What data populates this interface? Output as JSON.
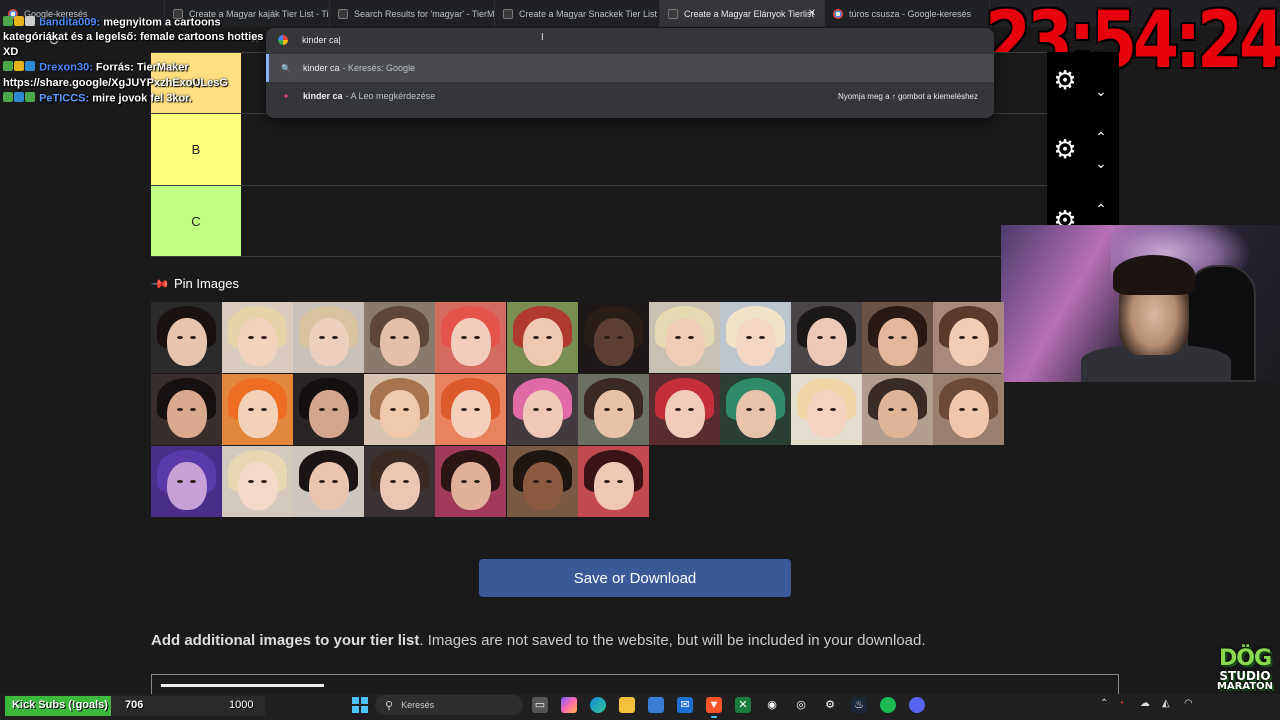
{
  "browser": {
    "tabs": [
      {
        "label": "Google-keresés",
        "favicon": "google"
      },
      {
        "label": "Create a Magyar kaják Tier List - Tier",
        "favicon": "tiermaker"
      },
      {
        "label": "Search Results for 'magyar' - TierMak",
        "favicon": "tiermaker"
      },
      {
        "label": "Create a Magyar Snackek Tier List - T",
        "favicon": "tiermaker"
      },
      {
        "label": "Create a Magyar Elányok Tierlist",
        "favicon": "tiermaker",
        "active": true
      },
      {
        "label": "túros csusza - Google-keresés",
        "favicon": "google"
      }
    ],
    "close_glyph": "✕",
    "omnibox": {
      "value": "kinder ca",
      "suggestions": [
        {
          "query": "kinder ca",
          "suffix": " - Keresés: Google",
          "icon": "search-icon",
          "selected": true
        },
        {
          "query": "kinder ca",
          "suffix": " - A Leo megkérdezése",
          "icon": "leo-icon",
          "hint": "Nyomja meg a ↑ gombot a kiemeléshez"
        }
      ]
    }
  },
  "chat": {
    "lines": [
      {
        "user": "bandita009:",
        "text": "megnyitom a cartoons kategóriákat és a legelső: female cartoons hotties XD",
        "badges": [
          "#4aa84a",
          "#e6b31e",
          "#cccccc"
        ]
      },
      {
        "user": "Drexon30:",
        "text": "Forrás: TierMaker https://share.google/XgJUYPxzhExoULesG",
        "badges": [
          "#4aa84a",
          "#e6b31e",
          "#2d8bd6"
        ]
      },
      {
        "user": "PeTICCS:",
        "text": "mire jovok fel 3kor.",
        "badges": [
          "#4aa84a",
          "#2d8bd6",
          "#4aa84a"
        ]
      }
    ]
  },
  "clock": "23:54:24",
  "tiers": [
    {
      "label": "A",
      "color": "#ffdf80"
    },
    {
      "label": "B",
      "color": "#ffff7f"
    },
    {
      "label": "C",
      "color": "#bfff7f"
    }
  ],
  "pin": {
    "title": "Pin Images"
  },
  "thumbnails": [
    {
      "bg": "#2a2a2a",
      "hair": "#1a1210",
      "skin": "#e7c4ad"
    },
    {
      "bg": "#d9cbbd",
      "hair": "#e7d3a8",
      "skin": "#f1d2bd"
    },
    {
      "bg": "#c9c1b9",
      "hair": "#d9c2a0",
      "skin": "#ecd0bd"
    },
    {
      "bg": "#8a7a6c",
      "hair": "#5e4638",
      "skin": "#e2c0aa"
    },
    {
      "bg": "#d56b5e",
      "hair": "#e5544a",
      "skin": "#f3cdbb"
    },
    {
      "bg": "#7a8e52",
      "hair": "#b03a2e",
      "skin": "#f0c8b2"
    },
    {
      "bg": "#1d1717",
      "hair": "#2a1c16",
      "skin": "#5c3e33"
    },
    {
      "bg": "#c8c0b0",
      "hair": "#e6dab2",
      "skin": "#f0cdb6"
    },
    {
      "bg": "#bdc6cf",
      "hair": "#f0e4c8",
      "skin": "#f4d6c4"
    },
    {
      "bg": "#4a4546",
      "hair": "#1b1818",
      "skin": "#ebc9b6"
    },
    {
      "bg": "#6b5446",
      "hair": "#2a1913",
      "skin": "#e4b79c"
    },
    {
      "bg": "#a78a7c",
      "hair": "#5a3a2a",
      "skin": "#f2cdb5"
    },
    {
      "bg": "#3a2e2c",
      "hair": "#161010",
      "skin": "#d9a88e"
    },
    {
      "bg": "#e2873b",
      "hair": "#ee6d22",
      "skin": "#f3d0b8"
    },
    {
      "bg": "#2b2424",
      "hair": "#141010",
      "skin": "#d4a690"
    },
    {
      "bg": "#d9c3b1",
      "hair": "#a8734f",
      "skin": "#f0c9ad"
    },
    {
      "bg": "#e9835e",
      "hair": "#dc5a2c",
      "skin": "#f4cfbb"
    },
    {
      "bg": "#433a40",
      "hair": "#e06aa5",
      "skin": "#f0c8b8"
    },
    {
      "bg": "#6b7060",
      "hair": "#3a2a22",
      "skin": "#e8c2a8"
    },
    {
      "bg": "#5a2c2e",
      "hair": "#c42d3a",
      "skin": "#f2cbbb"
    },
    {
      "bg": "#2a3e34",
      "hair": "#2f8a6a",
      "skin": "#e7c3ab"
    },
    {
      "bg": "#e4dccc",
      "hair": "#f0d6a6",
      "skin": "#f4d3c0"
    },
    {
      "bg": "#b39d8e",
      "hair": "#3a2a25",
      "skin": "#e0b497"
    },
    {
      "bg": "#9b7f6e",
      "hair": "#6c4a38",
      "skin": "#f0c7ad"
    },
    {
      "bg": "#4a2d88",
      "hair": "#5a3aa8",
      "skin": "#c7a0d8"
    },
    {
      "bg": "#d5c8bd",
      "hair": "#e9d6b3",
      "skin": "#f5d9c8"
    },
    {
      "bg": "#cfc6bf",
      "hair": "#1b1414",
      "skin": "#e9c5b0"
    },
    {
      "bg": "#3a3232",
      "hair": "#3b2a22",
      "skin": "#eac7b2"
    },
    {
      "bg": "#a13a5a",
      "hair": "#2a1414",
      "skin": "#e0b09a"
    },
    {
      "bg": "#7a5a44",
      "hair": "#1e1410",
      "skin": "#8c5a40"
    },
    {
      "bg": "#c24a4f",
      "hair": "#3a1414",
      "skin": "#f0c6b4"
    }
  ],
  "save_button": "Save or Download",
  "add_images": {
    "bold": "Add additional images to your tier list",
    "rest": ". Images are not saved to the website, but will be included in your download."
  },
  "goals": {
    "label": "Kick Subs (!goals)",
    "current": "706",
    "max": "1000",
    "progress": 0.706,
    "fill_color": "#3cb83c"
  },
  "taskbar": {
    "search_label": "Keresés"
  },
  "logo": {
    "line1": "DÖG",
    "line2": "STUDIO",
    "line3": "MARATON"
  }
}
